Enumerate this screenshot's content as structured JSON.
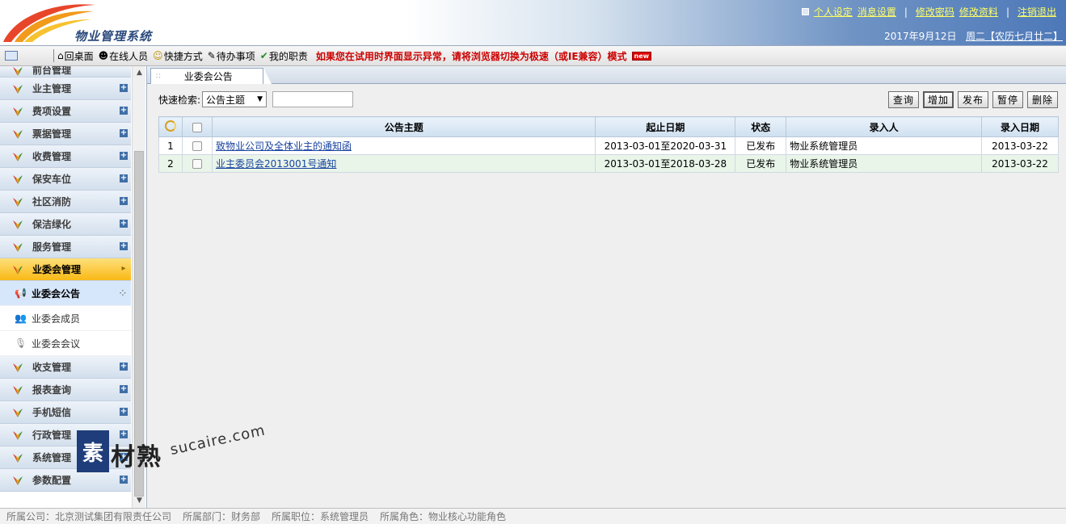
{
  "header": {
    "app_title": "物业管理系统",
    "links": [
      {
        "label": "个人设定"
      },
      {
        "label": "消息设置"
      },
      {
        "label": "修改密码"
      },
      {
        "label": "修改资料"
      },
      {
        "label": "注销退出"
      }
    ],
    "date": "2017年9月12日",
    "weekday_lunar": "周二【农历七月廿二】"
  },
  "toolbar": {
    "items": [
      {
        "icon": "home-icon",
        "label": "回桌面"
      },
      {
        "icon": "online-users-icon",
        "label": "在线人员"
      },
      {
        "icon": "smiley-icon",
        "label": "快捷方式"
      },
      {
        "icon": "todo-icon",
        "label": "待办事项"
      },
      {
        "icon": "duty-icon",
        "label": "我的职责"
      }
    ],
    "warning": "如果您在试用时界面显示异常，请将浏览器切换为极速（或IE兼容）模式",
    "badge": "new"
  },
  "sidebar": {
    "top_clipped": "前台管理",
    "items_before": [
      {
        "label": "业主管理"
      },
      {
        "label": "费项设置"
      },
      {
        "label": "票据管理"
      },
      {
        "label": "收费管理"
      },
      {
        "label": "保安车位"
      },
      {
        "label": "社区消防"
      },
      {
        "label": "保洁绿化"
      },
      {
        "label": "服务管理"
      }
    ],
    "active_group": {
      "label": "业委会管理"
    },
    "sub_items": [
      {
        "label": "业委会公告",
        "icon": "megaphone-icon"
      },
      {
        "label": "业委会成员",
        "icon": "members-icon"
      },
      {
        "label": "业委会会议",
        "icon": "meeting-icon"
      }
    ],
    "items_after": [
      {
        "label": "收支管理"
      },
      {
        "label": "报表查询"
      },
      {
        "label": "手机短信"
      },
      {
        "label": "行政管理"
      },
      {
        "label": "系统管理"
      },
      {
        "label": "参数配置"
      }
    ]
  },
  "main": {
    "tab_label": "业委会公告",
    "search": {
      "label": "快速检索:",
      "field": "公告主题",
      "value": ""
    },
    "actions": [
      {
        "label": "查询"
      },
      {
        "label": "增加"
      },
      {
        "label": "发布"
      },
      {
        "label": "暂停"
      },
      {
        "label": "删除"
      }
    ],
    "table": {
      "columns": [
        "公告主题",
        "起止日期",
        "状态",
        "录入人",
        "录入日期"
      ],
      "rows": [
        {
          "num": "1",
          "title": "致物业公司及全体业主的通知函",
          "period": "2013-03-01至2020-03-31",
          "status": "已发布",
          "author": "物业系统管理员",
          "date": "2013-03-22"
        },
        {
          "num": "2",
          "title": "业主委员会2013001号通知",
          "period": "2013-03-01至2018-03-28",
          "status": "已发布",
          "author": "物业系统管理员",
          "date": "2013-03-22"
        }
      ]
    }
  },
  "statusbar": {
    "company": "所属公司：北京测试集团有限责任公司",
    "dept": "所属部门：财务部",
    "position": "所属职位：系统管理员",
    "role": "所属角色：物业核心功能角色"
  },
  "watermark": {
    "box": "素",
    "text": "材熟",
    "url": "sucaire.com"
  }
}
